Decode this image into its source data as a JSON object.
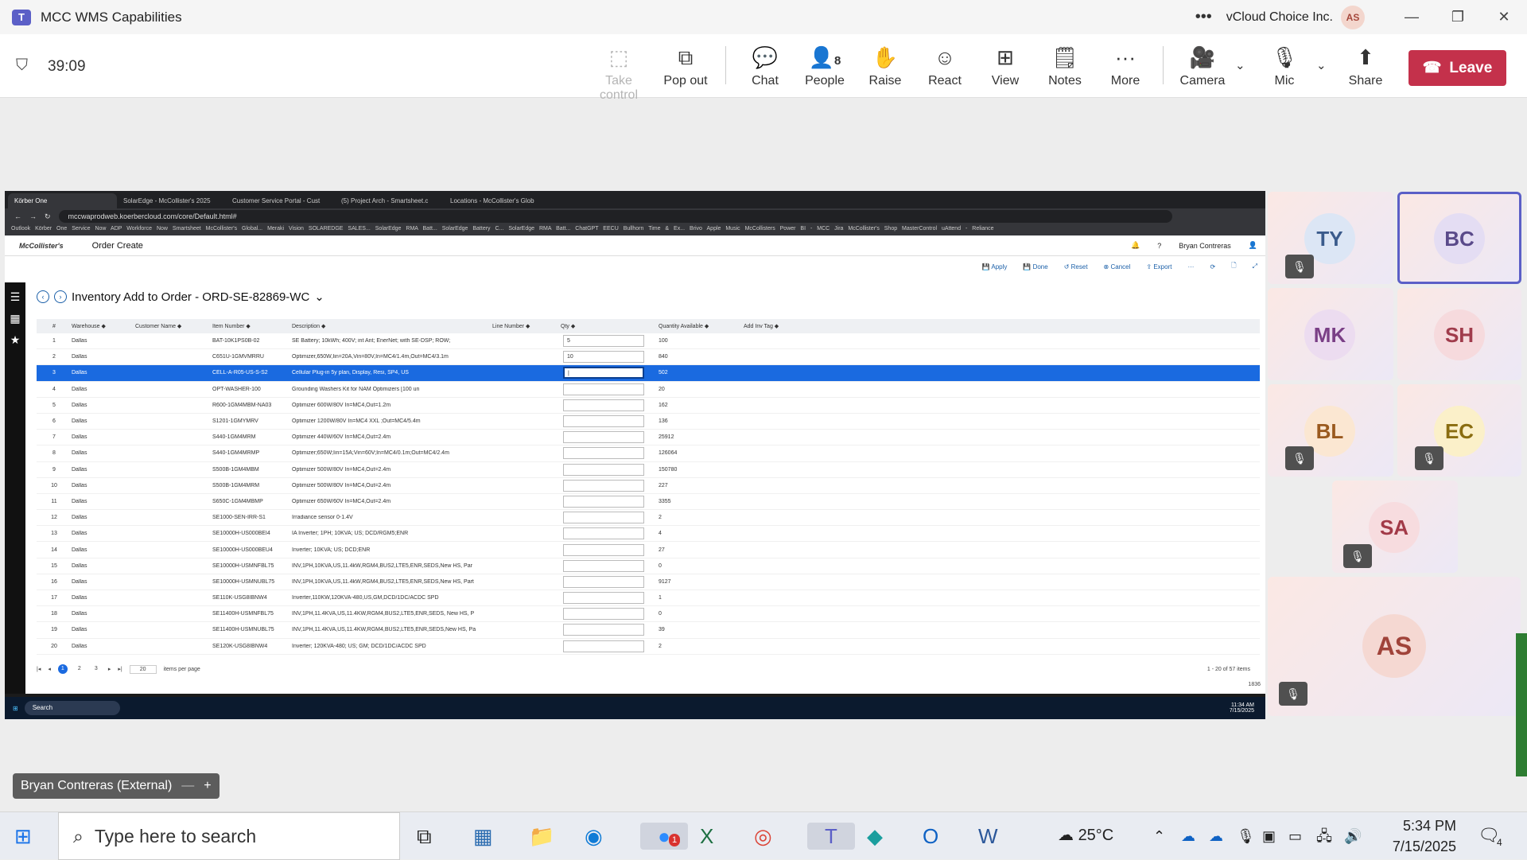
{
  "window": {
    "title": "MCC WMS Capabilities",
    "org": "vCloud Choice Inc.",
    "user_initials": "AS",
    "more": "•••"
  },
  "meeting": {
    "timer": "39:09",
    "controls": [
      {
        "label": "Take control",
        "icon": "⬚"
      },
      {
        "label": "Pop out",
        "icon": "⧉"
      },
      {
        "label": "Chat",
        "icon": "💬"
      },
      {
        "label": "People",
        "icon": "👤",
        "count": "8"
      },
      {
        "label": "Raise",
        "icon": "✋"
      },
      {
        "label": "React",
        "icon": "☺"
      },
      {
        "label": "View",
        "icon": "⊞"
      },
      {
        "label": "Notes",
        "icon": "🗒"
      },
      {
        "label": "More",
        "icon": "···"
      },
      {
        "label": "Camera",
        "icon": "🎥"
      },
      {
        "label": "Mic",
        "icon": "🎙"
      },
      {
        "label": "Share",
        "icon": "⬆"
      }
    ],
    "leave_label": "Leave"
  },
  "browser": {
    "tabs": [
      "Körber One",
      "SolarEdge - McCollister's 2025",
      "Customer Service Portal - Cust",
      "(5) Project Arch - Smartsheet.c",
      "Locations - McCollister's Glob"
    ],
    "url": "mccwaprodweb.koerbercloud.com/core/Default.html#",
    "bookmarks": "Outlook Körber One Service Now ADP Workforce Now Smartsheet McCollister's Global... Meraki Vision SOLAREDGE SALES... SolarEdge RMA Batt... SolarEdge Battery C... SolarEdge RMA Batt... ChatGPT EECU Bullhorn Time & Ex... Brivo Apple Music McCollisters Power BI - MCC Jira McCollister's Shop MasterControl uAttend - Reliance"
  },
  "app": {
    "logo": "McCollister's",
    "module": "Order Create",
    "help": "?",
    "user": "Bryan Contreras",
    "toolbar": [
      "Apply",
      "Done",
      "Reset",
      "Cancel",
      "Export",
      "···"
    ],
    "page_title": "Inventory Add to Order - ORD-SE-82869-WC",
    "columns": [
      "#",
      "Warehouse ◆",
      "Customer Name ◆",
      "Item Number ◆",
      "Description ◆",
      "Line Number ◆",
      "Qty ◆",
      "Quantity Available ◆",
      "Add Inv Tag ◆"
    ],
    "rows": [
      {
        "n": "1",
        "wh": "Dallas",
        "item": "BAT-10K1PS0B-02",
        "desc": "SE Battery; 10kWh; 400V; int Ant; EnerNet; with SE-DSP; ROW;",
        "qty": "5",
        "avail": "100"
      },
      {
        "n": "2",
        "wh": "Dallas",
        "item": "C651U-1GMVMRRU",
        "desc": "Optimizer,650W,Iin=20A,Vin=80V,In=MC4/1.4m,Out=MC4/3.1m",
        "qty": "10",
        "avail": "840"
      },
      {
        "n": "3",
        "wh": "Dallas",
        "item": "CELL-A-R05-US-S-S2",
        "desc": "Cellular Plug-in 5y plan, Display, Resi, SP4, US",
        "qty": "|",
        "avail": "502"
      },
      {
        "n": "4",
        "wh": "Dallas",
        "item": "OPT-WASHER-100",
        "desc": "Grounding Washers Kit for NAM Optimizers [100 un",
        "qty": "",
        "avail": "20"
      },
      {
        "n": "5",
        "wh": "Dallas",
        "item": "R600-1GM4MBM-NA03",
        "desc": "Optimizer 600W/80V In=MC4,Out=1.2m",
        "qty": "",
        "avail": "162"
      },
      {
        "n": "6",
        "wh": "Dallas",
        "item": "S1201-1GMYMRV",
        "desc": "Optimizer 1200W/80V In=MC4 XXL ;Out=MC4/5.4m",
        "qty": "",
        "avail": "136"
      },
      {
        "n": "7",
        "wh": "Dallas",
        "item": "S440-1GM4MRM",
        "desc": "Optimizer 440W/60V In=MC4,Out=2.4m",
        "qty": "",
        "avail": "25912"
      },
      {
        "n": "8",
        "wh": "Dallas",
        "item": "S440-1GM4MRMP",
        "desc": "Optimizer;650W;Iin=15A;Vin=60V;In=MC4/0.1m;Out=MC4/2.4m",
        "qty": "",
        "avail": "126064"
      },
      {
        "n": "9",
        "wh": "Dallas",
        "item": "S500B-1GM4MBM",
        "desc": "Optimizer 500W/80V In=MC4,Out=2.4m",
        "qty": "",
        "avail": "150780"
      },
      {
        "n": "10",
        "wh": "Dallas",
        "item": "S500B-1GM4MRM",
        "desc": "Optimizer 500W/80V In=MC4,Out=2.4m",
        "qty": "",
        "avail": "227"
      },
      {
        "n": "11",
        "wh": "Dallas",
        "item": "S650C-1GM4MBMP",
        "desc": "Optimizer 650W/60V In=MC4,Out=2.4m",
        "qty": "",
        "avail": "3355"
      },
      {
        "n": "12",
        "wh": "Dallas",
        "item": "SE1000-SEN-IRR-S1",
        "desc": "Irradiance sensor 0-1.4V",
        "qty": "",
        "avail": "2"
      },
      {
        "n": "13",
        "wh": "Dallas",
        "item": "SE10000H-US000BEI4",
        "desc": "IA Inverter; 1PH; 10KVA; US; DCD/RGM5;ENR",
        "qty": "",
        "avail": "4"
      },
      {
        "n": "14",
        "wh": "Dallas",
        "item": "SE10000H-US000BEU4",
        "desc": "Inverter; 10KVA; US; DCD;ENR",
        "qty": "",
        "avail": "27"
      },
      {
        "n": "15",
        "wh": "Dallas",
        "item": "SE10000H-USMNFBL75",
        "desc": "INV,1PH,10KVA,US,11.4kW,RGM4,BUS2,LTE5,ENR,SEDS,New HS, Par",
        "qty": "",
        "avail": "0"
      },
      {
        "n": "16",
        "wh": "Dallas",
        "item": "SE10000H-USMNUBL75",
        "desc": "INV,1PH,10KVA,US,11.4kW,RGM4,BUS2,LTE5,ENR,SEDS,New HS, Part",
        "qty": "",
        "avail": "9127"
      },
      {
        "n": "17",
        "wh": "Dallas",
        "item": "SE110K-USG8IBNW4",
        "desc": "Inverter,110KW,120KVA-480,US,GM,DCD/1DC/ACDC SPD",
        "qty": "",
        "avail": "1"
      },
      {
        "n": "18",
        "wh": "Dallas",
        "item": "SE11400H-USMNFBL75",
        "desc": "INV,1PH,11.4KVA,US,11.4KW,RGM4,BUS2,LTE5,ENR,SEDS, New HS, P",
        "qty": "",
        "avail": "0"
      },
      {
        "n": "19",
        "wh": "Dallas",
        "item": "SE11400H-USMNUBL75",
        "desc": "INV,1PH,11.4KVA,US,11.4KW,RGM4,BUS2,LTE5,ENR,SEDS,New HS, Pa",
        "qty": "",
        "avail": "39"
      },
      {
        "n": "20",
        "wh": "Dallas",
        "item": "SE120K-USG8IBNW4",
        "desc": "Inverter; 120KVA-480; US; GM; DCD/1DC/ACDC SPD",
        "qty": "",
        "avail": "2"
      }
    ],
    "pager": {
      "pages": [
        "1",
        "2",
        "3"
      ],
      "per_page": "20",
      "per_page_label": "items per page",
      "summary": "1 - 20 of 57 items",
      "footer_num": "1836"
    }
  },
  "remote_taskbar": {
    "search": "Search",
    "time": "11:34 AM",
    "date": "7/15/2025"
  },
  "participants": [
    {
      "initials": "TY",
      "bg": "#dce6f5",
      "fg": "#3b5b8c"
    },
    {
      "initials": "BC",
      "bg": "#e4ddf3",
      "fg": "#5a4a8a"
    },
    {
      "initials": "MK",
      "bg": "#ecdcf0",
      "fg": "#7a3f86"
    },
    {
      "initials": "SH",
      "bg": "#f6dadd",
      "fg": "#a03c4c"
    },
    {
      "initials": "BL",
      "bg": "#fbe7d2",
      "fg": "#9a5a1f"
    },
    {
      "initials": "EC",
      "bg": "#fbf0c9",
      "fg": "#8a6d10"
    },
    {
      "initials": "SA",
      "bg": "#f7dcdf",
      "fg": "#a23a48"
    },
    {
      "initials": "AS",
      "bg": "#f5d8d2",
      "fg": "#a0433a"
    }
  ],
  "presenter": {
    "name": "Bryan Contreras (External)"
  },
  "taskbar": {
    "search_placeholder": "Type here to search",
    "weather": "25°C",
    "time": "5:34 PM",
    "date": "7/15/2025",
    "badge": "1",
    "notif_count": "4"
  }
}
